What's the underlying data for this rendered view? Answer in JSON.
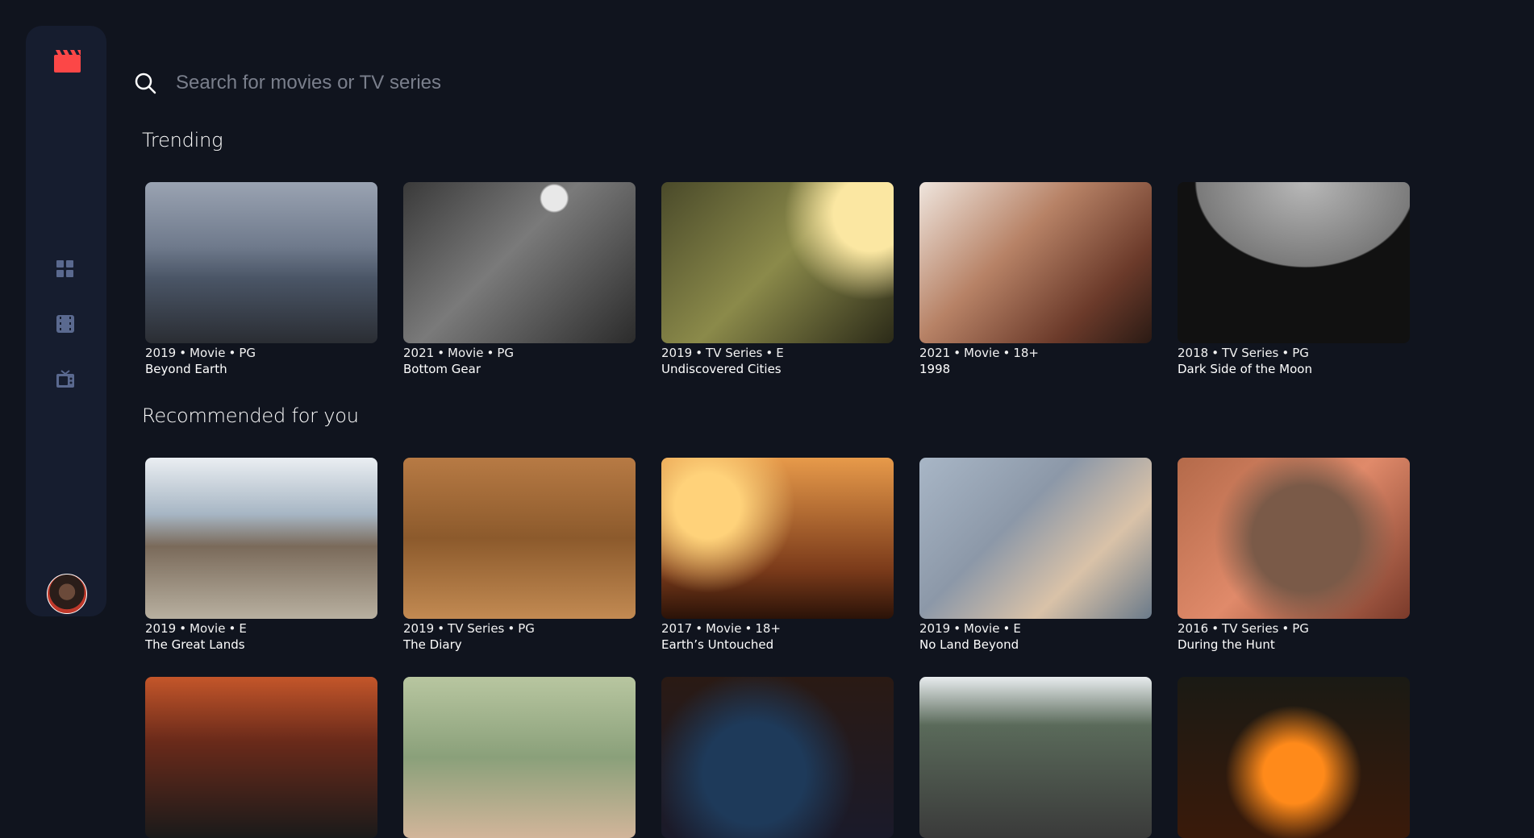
{
  "sidebar": {
    "nav": [
      {
        "name": "home-grid-icon"
      },
      {
        "name": "movies-film-icon"
      },
      {
        "name": "tv-series-icon"
      }
    ]
  },
  "search": {
    "placeholder": "Search for movies or TV series"
  },
  "sections": {
    "trending": {
      "title": "Trending",
      "items": [
        {
          "year": "2019",
          "category": "Movie",
          "rating": "PG",
          "title": "Beyond Earth"
        },
        {
          "year": "2021",
          "category": "Movie",
          "rating": "PG",
          "title": "Bottom Gear"
        },
        {
          "year": "2019",
          "category": "TV Series",
          "rating": "E",
          "title": "Undiscovered Cities"
        },
        {
          "year": "2021",
          "category": "Movie",
          "rating": "18+",
          "title": "1998"
        },
        {
          "year": "2018",
          "category": "TV Series",
          "rating": "PG",
          "title": "Dark Side of the Moon"
        }
      ]
    },
    "recommended": {
      "title": "Recommended for you",
      "items": [
        {
          "year": "2019",
          "category": "Movie",
          "rating": "E",
          "title": "The Great Lands"
        },
        {
          "year": "2019",
          "category": "TV Series",
          "rating": "PG",
          "title": "The Diary"
        },
        {
          "year": "2017",
          "category": "Movie",
          "rating": "18+",
          "title": "Earth’s Untouched"
        },
        {
          "year": "2019",
          "category": "Movie",
          "rating": "E",
          "title": "No Land Beyond"
        },
        {
          "year": "2016",
          "category": "TV Series",
          "rating": "PG",
          "title": "During the Hunt"
        }
      ]
    }
  },
  "colors": {
    "background": "#10141e",
    "sidebar": "#161d2f",
    "accent": "#fc4747",
    "nav_icon": "#5a698f"
  }
}
